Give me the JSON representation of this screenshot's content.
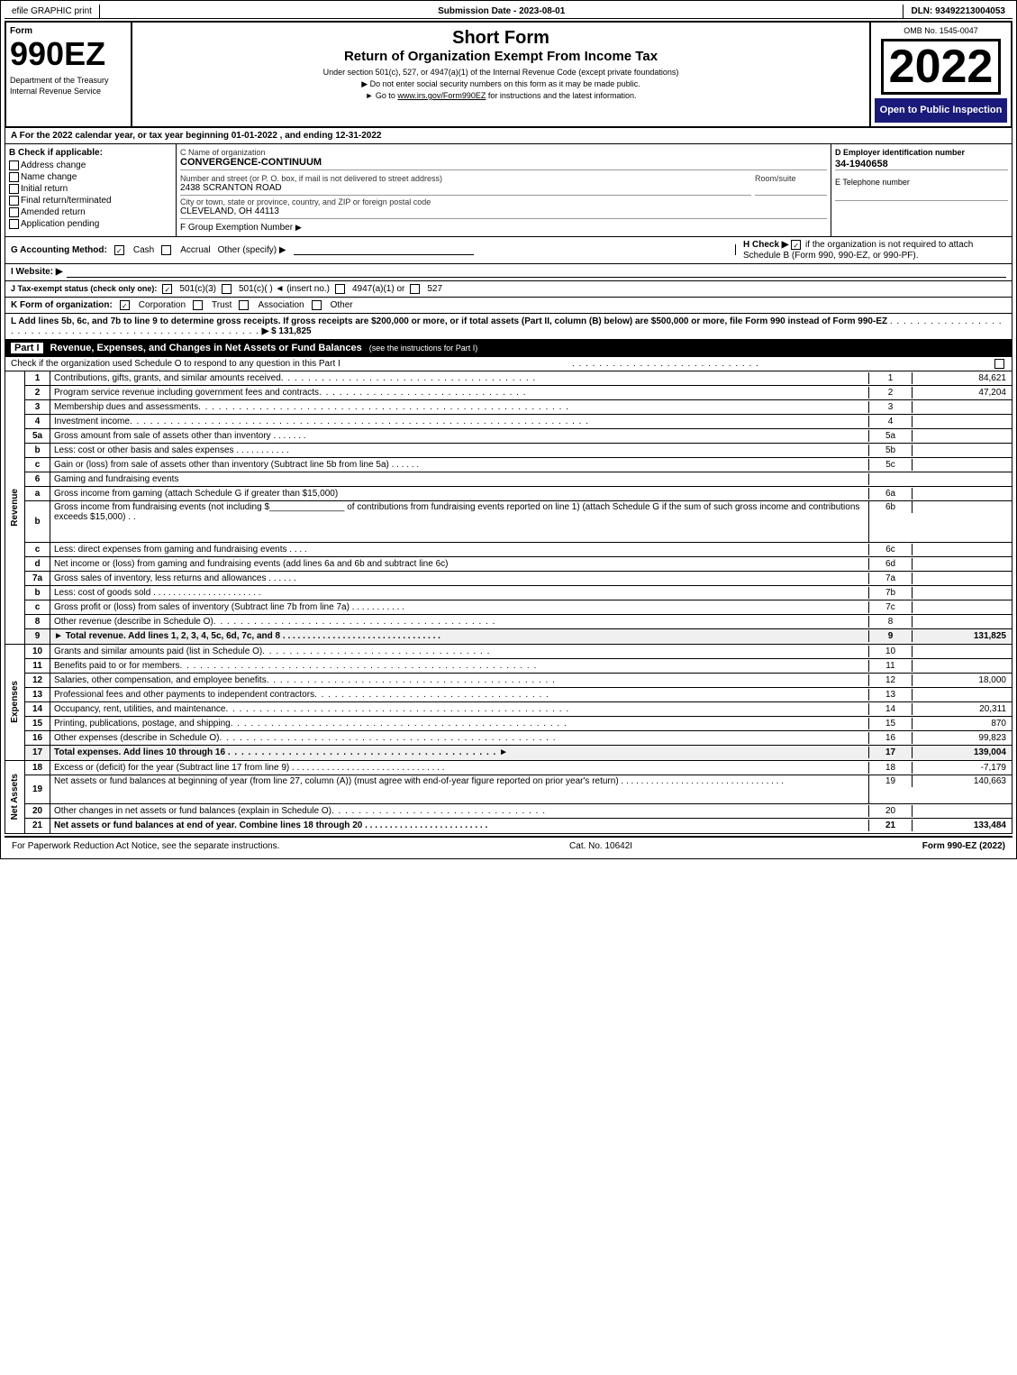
{
  "topBar": {
    "efile": "efile GRAPHIC print",
    "submission": "Submission Date - 2023-08-01",
    "dln": "DLN: 93492213004053"
  },
  "header": {
    "formNumber": "990EZ",
    "title": "Short Form",
    "subtitle": "Return of Organization Exempt From Income Tax",
    "sub1": "Under section 501(c), 527, or 4947(a)(1) of the Internal Revenue Code (except private foundations)",
    "note1": "▶ Do not enter social security numbers on this form as it may be made public.",
    "note2": "▶ Go to www.irs.gov/Form990EZ for instructions and the latest information.",
    "omb": "OMB No. 1545-0047",
    "year": "2022",
    "openText": "Open to Public Inspection",
    "dept": "Department of the Treasury Internal Revenue Service"
  },
  "sectionA": {
    "text": "A For the 2022 calendar year, or tax year beginning 01-01-2022 , and ending 12-31-2022"
  },
  "checkApplicable": {
    "label": "B Check if applicable:",
    "items": [
      {
        "label": "Address change",
        "checked": false
      },
      {
        "label": "Name change",
        "checked": false
      },
      {
        "label": "Initial return",
        "checked": false
      },
      {
        "label": "Final return/terminated",
        "checked": false
      },
      {
        "label": "Amended return",
        "checked": false
      },
      {
        "label": "Application pending",
        "checked": false
      }
    ]
  },
  "orgInfo": {
    "nameLabel": "C Name of organization",
    "nameValue": "CONVERGENCE-CONTINUUM",
    "addressLabel": "Number and street (or P. O. box, if mail is not delivered to street address)",
    "addressValue": "2438 SCRANTON ROAD",
    "roomLabel": "Room/suite",
    "roomValue": "",
    "cityLabel": "City or town, state or province, country, and ZIP or foreign postal code",
    "cityValue": "CLEVELAND, OH  44113",
    "groupLabel": "F Group Exemption Number",
    "groupValue": "▶"
  },
  "employerId": {
    "label": "D Employer identification number",
    "value": "34-1940658",
    "phoneLabel": "E Telephone number",
    "phoneValue": ""
  },
  "accounting": {
    "label": "G Accounting Method:",
    "cashLabel": "Cash",
    "cashChecked": true,
    "accrualLabel": "Accrual",
    "accrualChecked": false,
    "otherLabel": "Other (specify) ▶",
    "otherValue": ""
  },
  "checkH": {
    "text": "H  Check ▶",
    "checked": true,
    "desc": "if the organization is not required to attach Schedule B (Form 990, 990-EZ, or 990-PF)."
  },
  "website": {
    "label": "I Website: ▶",
    "value": ""
  },
  "taxExempt": {
    "label": "J Tax-exempt status (check only one):",
    "options": [
      {
        "label": "501(c)(3)",
        "checked": true
      },
      {
        "label": "501(c)(   ) ◄ (insert no.)",
        "checked": false
      },
      {
        "label": "4947(a)(1) or",
        "checked": false
      },
      {
        "label": "527",
        "checked": false
      }
    ]
  },
  "formK": {
    "label": "K Form of organization:",
    "options": [
      {
        "label": "Corporation",
        "checked": true
      },
      {
        "label": "Trust",
        "checked": false
      },
      {
        "label": "Association",
        "checked": false
      },
      {
        "label": "Other",
        "checked": false
      }
    ]
  },
  "lineL": {
    "text": "L Add lines 5b, 6c, and 7b to line 9 to determine gross receipts. If gross receipts are $200,000 or more, or if total assets (Part II, column (B) below) are $500,000 or more, file Form 990 instead of Form 990-EZ",
    "dots": ". . . . . . . . . . . . . . . . . . . . . . . . . . . . . . . . . . . . . . . . . . . . . . . . . . . . . .",
    "arrow": "▶ $",
    "value": "131,825"
  },
  "partI": {
    "label": "Part I",
    "title": "Revenue, Expenses, and Changes in Net Assets or Fund Balances",
    "seeInstructions": "(see the instructions for Part I)",
    "checkLine": "Check if the organization used Schedule O to respond to any question in this Part I",
    "checkDots": ". . . . . . . . . . . . . . . . . . . . . . . . . . . .",
    "sideLabel": "Revenue",
    "rows": [
      {
        "num": "1",
        "desc": "Contributions, gifts, grants, and similar amounts received",
        "dots": ". . . . . . . . . . . . . . . . . . . . . . . . . . . . . . . . . . . . . .",
        "ref": "1",
        "value": "84,621"
      },
      {
        "num": "2",
        "desc": "Program service revenue including government fees and contracts",
        "dots": ". . . . . . . . . . . . . . . . . . . . . . . . . . . . . . .",
        "ref": "2",
        "value": "47,204"
      },
      {
        "num": "3",
        "desc": "Membership dues and assessments",
        "dots": ". . . . . . . . . . . . . . . . . . . . . . . . . . . . . . . . . . . . . . . . . . . . . . . . . . . . . . .",
        "ref": "3",
        "value": ""
      },
      {
        "num": "4",
        "desc": "Investment income",
        "dots": ". . . . . . . . . . . . . . . . . . . . . . . . . . . . . . . . . . . . . . . . . . . . . . . . . . . . . . . . . . . . . . . . . . . .",
        "ref": "4",
        "value": ""
      },
      {
        "num": "5a",
        "desc": "Gross amount from sale of assets other than inventory  . . . . . . .",
        "ref": "5a",
        "value": ""
      },
      {
        "num": "b",
        "desc": "Less: cost or other basis and sales expenses  . . . . . . . . . . .",
        "ref": "5b",
        "value": ""
      },
      {
        "num": "c",
        "desc": "Gain or (loss) from sale of assets other than inventory (Subtract line 5b from line 5a)  . . . . . .",
        "ref": "5c",
        "value": ""
      },
      {
        "num": "6",
        "desc": "Gaming and fundraising events",
        "dots": "",
        "ref": "",
        "value": ""
      },
      {
        "num": "a",
        "desc": "Gross income from gaming (attach Schedule G if greater than $15,000)",
        "ref": "6a",
        "value": ""
      },
      {
        "num": "b",
        "desc": "Gross income from fundraising events (not including $_______________  of contributions from fundraising events reported on line 1) (attach Schedule G if the sum of such gross income and contributions exceeds $15,000)  . .",
        "ref": "6b",
        "value": ""
      },
      {
        "num": "c",
        "desc": "Less: direct expenses from gaming and fundraising events  . . . .",
        "ref": "6c",
        "value": ""
      },
      {
        "num": "d",
        "desc": "Net income or (loss) from gaming and fundraising events (add lines 6a and 6b and subtract line 6c)",
        "ref": "6d",
        "value": ""
      },
      {
        "num": "7a",
        "desc": "Gross sales of inventory, less returns and allowances  . . . . . .",
        "ref": "7a",
        "value": ""
      },
      {
        "num": "b",
        "desc": "Less: cost of goods sold  . . . . . . . . . . . . . . . . . . . . . .",
        "ref": "7b",
        "value": ""
      },
      {
        "num": "c",
        "desc": "Gross profit or (loss) from sales of inventory (Subtract line 7b from line 7a)  . . . . . . . . . . .",
        "ref": "7c",
        "value": ""
      },
      {
        "num": "8",
        "desc": "Other revenue (describe in Schedule O)",
        "dots": ". . . . . . . . . . . . . . . . . . . . . . . . . . . . . . . . . . . . . . . . . .",
        "ref": "8",
        "value": ""
      },
      {
        "num": "9",
        "desc": "Total revenue. Add lines 1, 2, 3, 4, 5c, 6d, 7c, and 8  . . . . . . . . . . . . . . . . . . . . . . . . . . . . . . . .",
        "ref": "9",
        "value": "131,825",
        "bold": true,
        "arrow": "▶"
      }
    ],
    "expensesLabel": "Expenses",
    "expenseRows": [
      {
        "num": "10",
        "desc": "Grants and similar amounts paid (list in Schedule O)",
        "dots": ". . . . . . . . . . . . . . . . . . . . . . . . . . . . . . . . . .",
        "ref": "10",
        "value": ""
      },
      {
        "num": "11",
        "desc": "Benefits paid to or for members",
        "dots": ". . . . . . . . . . . . . . . . . . . . . . . . . . . . . . . . . . . . . . . . . . . . . . . . . . . . .",
        "ref": "11",
        "value": ""
      },
      {
        "num": "12",
        "desc": "Salaries, other compensation, and employee benefits",
        "dots": ". . . . . . . . . . . . . . . . . . . . . . . . . . . . . . . . . . . . . . . . . . .",
        "ref": "12",
        "value": "18,000"
      },
      {
        "num": "13",
        "desc": "Professional fees and other payments to independent contractors",
        "dots": ". . . . . . . . . . . . . . . . . . . . . . . . . . . . . . . . . . .",
        "ref": "13",
        "value": ""
      },
      {
        "num": "14",
        "desc": "Occupancy, rent, utilities, and maintenance",
        "dots": ". . . . . . . . . . . . . . . . . . . . . . . . . . . . . . . . . . . . . . . . . . . . . . . . . . .",
        "ref": "14",
        "value": "20,311"
      },
      {
        "num": "15",
        "desc": "Printing, publications, postage, and shipping",
        "dots": ". . . . . . . . . . . . . . . . . . . . . . . . . . . . . . . . . . . . . . . . . . . . . . . . . .",
        "ref": "15",
        "value": "870"
      },
      {
        "num": "16",
        "desc": "Other expenses (describe in Schedule O)",
        "dots": ". . . . . . . . . . . . . . . . . . . . . . . . . . . . . . . . . . . . . . . . . . . . . . . . . .",
        "ref": "16",
        "value": "99,823"
      },
      {
        "num": "17",
        "desc": "Total expenses. Add lines 10 through 16",
        "dots": ". . . . . . . . . . . . . . . . . . . . . . . . . . . . . . . . . . . . . . . .",
        "ref": "17",
        "value": "139,004",
        "bold": true,
        "arrow": "▶"
      }
    ],
    "netAssetsLabel": "Net Assets",
    "netRows": [
      {
        "num": "18",
        "desc": "Excess or (deficit) for the year (Subtract line 17 from line 9)  . . . . . . . . . . . . . . . . . . . . . . . . . . . . . . .",
        "ref": "18",
        "value": "-7,179"
      },
      {
        "num": "19",
        "desc": "Net assets or fund balances at beginning of year (from line 27, column (A)) (must agree with end-of-year figure reported on prior year's return)  . . . . . . . . . . . . . . . . . . . . . . . . . . . . . . . . .",
        "ref": "19",
        "value": "140,663"
      },
      {
        "num": "20",
        "desc": "Other changes in net assets or fund balances (explain in Schedule O)",
        "dots": ". . . . . . . . . . . . . . . . . . . . . . . . . . . . . . . .",
        "ref": "20",
        "value": ""
      },
      {
        "num": "21",
        "desc": "Net assets or fund balances at end of year. Combine lines 18 through 20  . . . . . . . . . . . . . . . . . . . . . . . . .",
        "ref": "21",
        "value": "133,484"
      }
    ]
  },
  "footer": {
    "left": "For Paperwork Reduction Act Notice, see the separate instructions.",
    "middle": "Cat. No. 10642I",
    "right": "Form 990-EZ (2022)"
  }
}
